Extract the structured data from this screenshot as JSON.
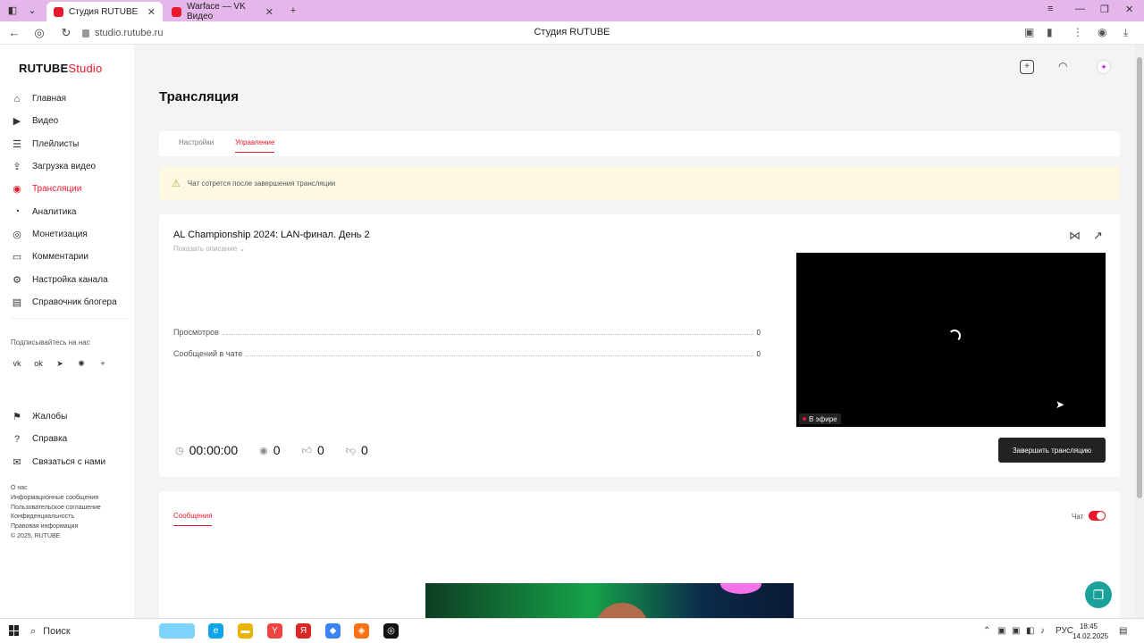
{
  "browser": {
    "tabs": [
      {
        "label": "Студия RUTUBE",
        "active": true
      },
      {
        "label": "Warface — VK Видео",
        "active": false
      }
    ],
    "new_tab_icon": "plus-icon",
    "url": "studio.rutube.ru",
    "window_title": "Студия RUTUBE"
  },
  "sidebar": {
    "logo_main": "RUTUBE",
    "logo_accent": "Studio",
    "items": [
      {
        "label": "Главная",
        "icon": "home-icon"
      },
      {
        "label": "Видео",
        "icon": "video-icon"
      },
      {
        "label": "Плейлисты",
        "icon": "playlist-icon"
      },
      {
        "label": "Загрузка видео",
        "icon": "upload-icon"
      },
      {
        "label": "Трансляции",
        "icon": "broadcast-icon",
        "active": true
      },
      {
        "label": "Аналитика",
        "icon": "analytics-icon"
      },
      {
        "label": "Монетизация",
        "icon": "money-icon"
      },
      {
        "label": "Комментарии",
        "icon": "comment-icon"
      },
      {
        "label": "Настройка канала",
        "icon": "gear-icon"
      },
      {
        "label": "Справочник блогера",
        "icon": "book-icon"
      }
    ],
    "subscribe_label": "Подписывайтесь на нас",
    "socials": [
      "vk-icon",
      "ok-icon",
      "telegram-icon",
      "dzen-icon",
      "plus-icon"
    ],
    "secondary": [
      {
        "label": "Жалобы",
        "icon": "flag-icon"
      },
      {
        "label": "Справка",
        "icon": "help-icon"
      },
      {
        "label": "Связаться с нами",
        "icon": "mail-icon"
      }
    ],
    "footer_links": [
      "О нас",
      "Информационные сообщения",
      "Пользовательское соглашение",
      "Конфиденциальность",
      "Правовая информация",
      "© 2025, RUTUBE"
    ]
  },
  "header": {
    "icons": [
      "add-video-icon",
      "bell-icon",
      "avatar"
    ]
  },
  "page": {
    "title": "Трансляция",
    "tabs": [
      {
        "label": "Настройки",
        "active": false
      },
      {
        "label": "Управление",
        "active": true
      }
    ],
    "warning": "Чат сотрется после завершения трансляции"
  },
  "stream": {
    "title": "AL Championship 2024: LAN-финал. День 2",
    "show_description": "Показать описание",
    "stats": [
      {
        "label": "Просмотров",
        "value": "0"
      },
      {
        "label": "Сообщений в чате",
        "value": "0"
      }
    ],
    "live_label": "В эфире",
    "metrics": [
      {
        "icon": "clock-icon",
        "value": "00:00:00"
      },
      {
        "icon": "viewers-icon",
        "value": "0"
      },
      {
        "icon": "like-icon",
        "value": "0"
      },
      {
        "icon": "dislike-icon",
        "value": "0"
      }
    ],
    "end_button": "Завершить трансляцию"
  },
  "messages": {
    "tab_label": "Сообщения",
    "chat_label": "Чат",
    "chat_enabled": true
  },
  "taskbar": {
    "search_label": "Поиск",
    "language": "РУС",
    "time": "18:45",
    "date": "14.02.2025"
  },
  "colors": {
    "accent": "#e8192c",
    "tab_strip": "#e4b6e9",
    "warning_bg": "#fdf8e2",
    "fab": "#1aa29a"
  }
}
